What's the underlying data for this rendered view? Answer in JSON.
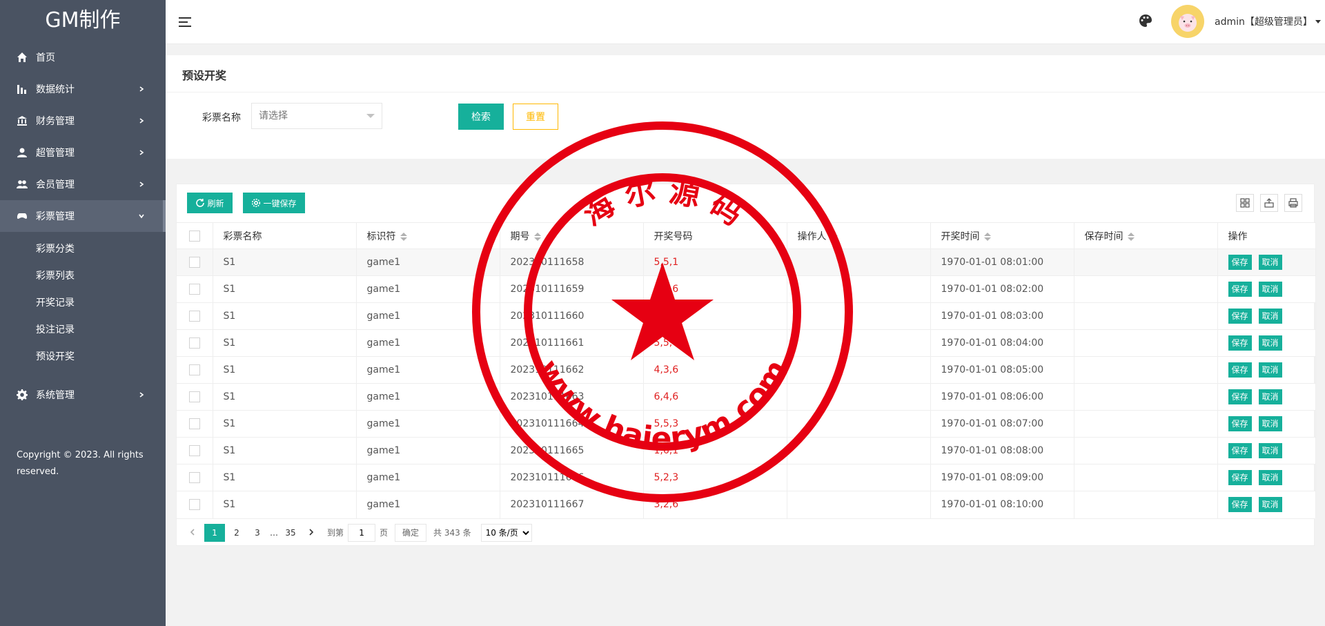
{
  "sidebar": {
    "logo": "GM制作",
    "items": [
      {
        "label": "首页",
        "icon": "home-icon"
      },
      {
        "label": "数据统计",
        "icon": "bar-chart-icon"
      },
      {
        "label": "财务管理",
        "icon": "bank-icon"
      },
      {
        "label": "超管管理",
        "icon": "user-icon"
      },
      {
        "label": "会员管理",
        "icon": "users-icon"
      },
      {
        "label": "彩票管理",
        "icon": "gamepad-icon"
      },
      {
        "label": "系统管理",
        "icon": "gear-icon"
      }
    ],
    "sub_items": [
      "彩票分类",
      "彩票列表",
      "开奖记录",
      "投注记录",
      "预设开奖"
    ],
    "copyright": "Copyright © 2023. All rights reserved."
  },
  "header": {
    "user": "admin【超级管理员】"
  },
  "search": {
    "title": "预设开奖",
    "label": "彩票名称",
    "placeholder": "请选择",
    "search_btn": "检索",
    "reset_btn": "重置"
  },
  "toolbar": {
    "refresh": "刷新",
    "save_all": "一键保存"
  },
  "table": {
    "columns": [
      "彩票名称",
      "标识符",
      "期号",
      "开奖号码",
      "操作人",
      "开奖时间",
      "保存时间",
      "操作"
    ],
    "save_label": "保存",
    "cancel_label": "取消",
    "rows": [
      {
        "name": "S1",
        "code": "game1",
        "issue": "202310111658",
        "numbers": "5,5,1",
        "operator": "",
        "time": "1970-01-01 08:01:00",
        "saved": ""
      },
      {
        "name": "S1",
        "code": "game1",
        "issue": "202310111659",
        "numbers": "6,6,6",
        "operator": "",
        "time": "1970-01-01 08:02:00",
        "saved": ""
      },
      {
        "name": "S1",
        "code": "game1",
        "issue": "202310111660",
        "numbers": "",
        "operator": "",
        "time": "1970-01-01 08:03:00",
        "saved": ""
      },
      {
        "name": "S1",
        "code": "game1",
        "issue": "202310111661",
        "numbers": "5,5,4",
        "operator": "",
        "time": "1970-01-01 08:04:00",
        "saved": ""
      },
      {
        "name": "S1",
        "code": "game1",
        "issue": "202310111662",
        "numbers": "4,3,6",
        "operator": "",
        "time": "1970-01-01 08:05:00",
        "saved": ""
      },
      {
        "name": "S1",
        "code": "game1",
        "issue": "202310111663",
        "numbers": "6,4,6",
        "operator": "",
        "time": "1970-01-01 08:06:00",
        "saved": ""
      },
      {
        "name": "S1",
        "code": "game1",
        "issue": "202310111664",
        "numbers": "5,5,3",
        "operator": "",
        "time": "1970-01-01 08:07:00",
        "saved": ""
      },
      {
        "name": "S1",
        "code": "game1",
        "issue": "202310111665",
        "numbers": "1,6,1",
        "operator": "",
        "time": "1970-01-01 08:08:00",
        "saved": ""
      },
      {
        "name": "S1",
        "code": "game1",
        "issue": "202310111666",
        "numbers": "5,2,3",
        "operator": "",
        "time": "1970-01-01 08:09:00",
        "saved": ""
      },
      {
        "name": "S1",
        "code": "game1",
        "issue": "202310111667",
        "numbers": "3,2,6",
        "operator": "",
        "time": "1970-01-01 08:10:00",
        "saved": ""
      }
    ]
  },
  "pager": {
    "pages": [
      "1",
      "2",
      "3",
      "…",
      "35"
    ],
    "current": "1",
    "goto_label": "到第",
    "goto_value": "1",
    "page_label": "页",
    "confirm": "确定",
    "total": "共 343 条",
    "per_page": "10 条/页"
  },
  "stamp": {
    "top_text": "海 尔 源 码",
    "bottom_text": "www.haierym.com",
    "color": "#e60012"
  }
}
